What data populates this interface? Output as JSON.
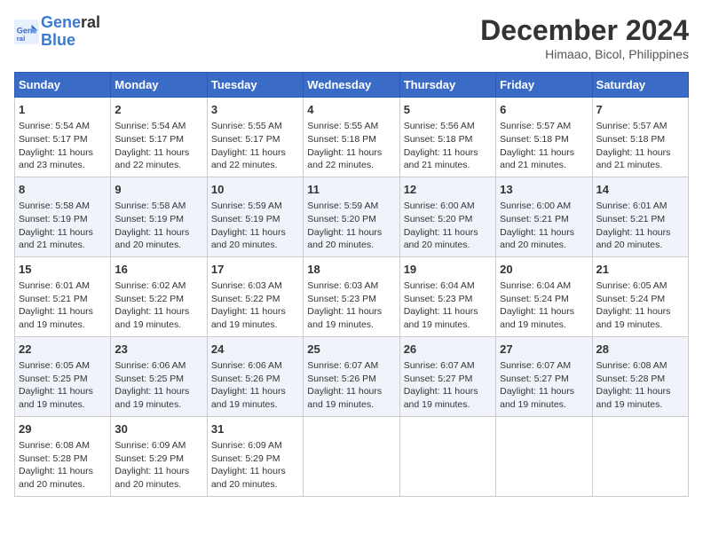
{
  "header": {
    "logo_line1": "General",
    "logo_line2": "Blue",
    "month": "December 2024",
    "location": "Himaao, Bicol, Philippines"
  },
  "weekdays": [
    "Sunday",
    "Monday",
    "Tuesday",
    "Wednesday",
    "Thursday",
    "Friday",
    "Saturday"
  ],
  "weeks": [
    [
      {
        "day": "1",
        "info": "Sunrise: 5:54 AM\nSunset: 5:17 PM\nDaylight: 11 hours\nand 23 minutes."
      },
      {
        "day": "2",
        "info": "Sunrise: 5:54 AM\nSunset: 5:17 PM\nDaylight: 11 hours\nand 22 minutes."
      },
      {
        "day": "3",
        "info": "Sunrise: 5:55 AM\nSunset: 5:17 PM\nDaylight: 11 hours\nand 22 minutes."
      },
      {
        "day": "4",
        "info": "Sunrise: 5:55 AM\nSunset: 5:18 PM\nDaylight: 11 hours\nand 22 minutes."
      },
      {
        "day": "5",
        "info": "Sunrise: 5:56 AM\nSunset: 5:18 PM\nDaylight: 11 hours\nand 21 minutes."
      },
      {
        "day": "6",
        "info": "Sunrise: 5:57 AM\nSunset: 5:18 PM\nDaylight: 11 hours\nand 21 minutes."
      },
      {
        "day": "7",
        "info": "Sunrise: 5:57 AM\nSunset: 5:18 PM\nDaylight: 11 hours\nand 21 minutes."
      }
    ],
    [
      {
        "day": "8",
        "info": "Sunrise: 5:58 AM\nSunset: 5:19 PM\nDaylight: 11 hours\nand 21 minutes."
      },
      {
        "day": "9",
        "info": "Sunrise: 5:58 AM\nSunset: 5:19 PM\nDaylight: 11 hours\nand 20 minutes."
      },
      {
        "day": "10",
        "info": "Sunrise: 5:59 AM\nSunset: 5:19 PM\nDaylight: 11 hours\nand 20 minutes."
      },
      {
        "day": "11",
        "info": "Sunrise: 5:59 AM\nSunset: 5:20 PM\nDaylight: 11 hours\nand 20 minutes."
      },
      {
        "day": "12",
        "info": "Sunrise: 6:00 AM\nSunset: 5:20 PM\nDaylight: 11 hours\nand 20 minutes."
      },
      {
        "day": "13",
        "info": "Sunrise: 6:00 AM\nSunset: 5:21 PM\nDaylight: 11 hours\nand 20 minutes."
      },
      {
        "day": "14",
        "info": "Sunrise: 6:01 AM\nSunset: 5:21 PM\nDaylight: 11 hours\nand 20 minutes."
      }
    ],
    [
      {
        "day": "15",
        "info": "Sunrise: 6:01 AM\nSunset: 5:21 PM\nDaylight: 11 hours\nand 19 minutes."
      },
      {
        "day": "16",
        "info": "Sunrise: 6:02 AM\nSunset: 5:22 PM\nDaylight: 11 hours\nand 19 minutes."
      },
      {
        "day": "17",
        "info": "Sunrise: 6:03 AM\nSunset: 5:22 PM\nDaylight: 11 hours\nand 19 minutes."
      },
      {
        "day": "18",
        "info": "Sunrise: 6:03 AM\nSunset: 5:23 PM\nDaylight: 11 hours\nand 19 minutes."
      },
      {
        "day": "19",
        "info": "Sunrise: 6:04 AM\nSunset: 5:23 PM\nDaylight: 11 hours\nand 19 minutes."
      },
      {
        "day": "20",
        "info": "Sunrise: 6:04 AM\nSunset: 5:24 PM\nDaylight: 11 hours\nand 19 minutes."
      },
      {
        "day": "21",
        "info": "Sunrise: 6:05 AM\nSunset: 5:24 PM\nDaylight: 11 hours\nand 19 minutes."
      }
    ],
    [
      {
        "day": "22",
        "info": "Sunrise: 6:05 AM\nSunset: 5:25 PM\nDaylight: 11 hours\nand 19 minutes."
      },
      {
        "day": "23",
        "info": "Sunrise: 6:06 AM\nSunset: 5:25 PM\nDaylight: 11 hours\nand 19 minutes."
      },
      {
        "day": "24",
        "info": "Sunrise: 6:06 AM\nSunset: 5:26 PM\nDaylight: 11 hours\nand 19 minutes."
      },
      {
        "day": "25",
        "info": "Sunrise: 6:07 AM\nSunset: 5:26 PM\nDaylight: 11 hours\nand 19 minutes."
      },
      {
        "day": "26",
        "info": "Sunrise: 6:07 AM\nSunset: 5:27 PM\nDaylight: 11 hours\nand 19 minutes."
      },
      {
        "day": "27",
        "info": "Sunrise: 6:07 AM\nSunset: 5:27 PM\nDaylight: 11 hours\nand 19 minutes."
      },
      {
        "day": "28",
        "info": "Sunrise: 6:08 AM\nSunset: 5:28 PM\nDaylight: 11 hours\nand 19 minutes."
      }
    ],
    [
      {
        "day": "29",
        "info": "Sunrise: 6:08 AM\nSunset: 5:28 PM\nDaylight: 11 hours\nand 20 minutes."
      },
      {
        "day": "30",
        "info": "Sunrise: 6:09 AM\nSunset: 5:29 PM\nDaylight: 11 hours\nand 20 minutes."
      },
      {
        "day": "31",
        "info": "Sunrise: 6:09 AM\nSunset: 5:29 PM\nDaylight: 11 hours\nand 20 minutes."
      },
      {
        "day": "",
        "info": ""
      },
      {
        "day": "",
        "info": ""
      },
      {
        "day": "",
        "info": ""
      },
      {
        "day": "",
        "info": ""
      }
    ]
  ]
}
